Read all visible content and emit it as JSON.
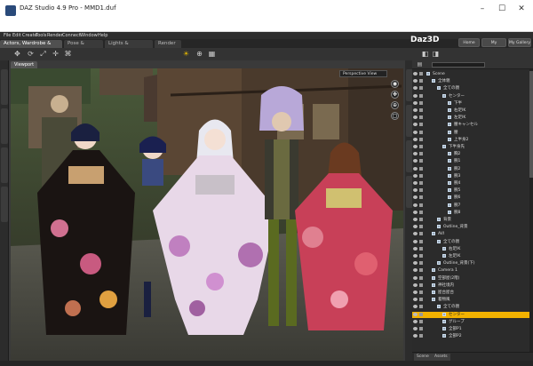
{
  "window": {
    "title": "DAZ Studio 4.9 Pro - MMD1.duf",
    "minimize": "–",
    "maximize": "☐",
    "close": "✕"
  },
  "menu": [
    "File",
    "Edit",
    "Create",
    "Tools",
    "Render",
    "Connect",
    "Window",
    "Help"
  ],
  "rooms": [
    "Actors, Wardrobe & Props",
    "Pose & Animate",
    "Lights & Cameras",
    "Render"
  ],
  "brand": "Daz3D",
  "top_buttons": [
    "Home",
    "My Account",
    "My Gallery"
  ],
  "viewport": {
    "tab": "Viewport",
    "camera": "Perspective View"
  },
  "scene": {
    "rows": [
      {
        "label": "Scene",
        "depth": 0
      },
      {
        "label": "全体親",
        "depth": 1
      },
      {
        "label": "全ての親",
        "depth": 2
      },
      {
        "label": "センター",
        "depth": 3
      },
      {
        "label": "下半",
        "depth": 4
      },
      {
        "label": "右足IK",
        "depth": 4
      },
      {
        "label": "左足IK",
        "depth": 4
      },
      {
        "label": "腰キャンセル",
        "depth": 4
      },
      {
        "label": "腰",
        "depth": 4
      },
      {
        "label": "上半身2",
        "depth": 4
      },
      {
        "label": "下半身先",
        "depth": 3
      },
      {
        "label": "胸2",
        "depth": 4
      },
      {
        "label": "腕1",
        "depth": 4
      },
      {
        "label": "腕2",
        "depth": 4
      },
      {
        "label": "腕3",
        "depth": 4
      },
      {
        "label": "腕4",
        "depth": 4
      },
      {
        "label": "腕5",
        "depth": 4
      },
      {
        "label": "腕6",
        "depth": 4
      },
      {
        "label": "腕7",
        "depth": 4
      },
      {
        "label": "腕8",
        "depth": 4
      },
      {
        "label": "背景",
        "depth": 2
      },
      {
        "label": "Outline_背景",
        "depth": 2
      },
      {
        "label": "AVI",
        "depth": 1
      },
      {
        "label": "全ての親",
        "depth": 2
      },
      {
        "label": "右足IK",
        "depth": 3
      },
      {
        "label": "左足IK",
        "depth": 3
      },
      {
        "label": "Outline_背景(下)",
        "depth": 2
      },
      {
        "label": "Camera 1",
        "depth": 1
      },
      {
        "label": "空部屋(2階)",
        "depth": 1
      },
      {
        "label": "神社境内",
        "depth": 1
      },
      {
        "label": "屋台屋台",
        "depth": 1
      },
      {
        "label": "着物風",
        "depth": 1
      },
      {
        "label": "全ての親",
        "depth": 2
      },
      {
        "label": "センター",
        "depth": 3,
        "selected": true
      },
      {
        "label": "グループ",
        "depth": 3
      },
      {
        "label": "全部P1",
        "depth": 3
      },
      {
        "label": "全部P2",
        "depth": 3
      }
    ]
  },
  "footer_tabs": [
    "Scene",
    "Assets"
  ],
  "colors": {
    "selection": "#f2b200",
    "panel": "#2b2b2b"
  }
}
